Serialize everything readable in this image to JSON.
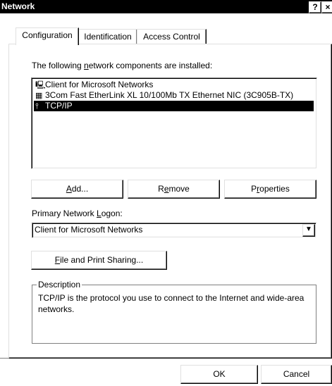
{
  "window": {
    "title": "Network",
    "help_label": "?",
    "close_label": "×"
  },
  "tabs": [
    {
      "label": "Configuration",
      "active": true
    },
    {
      "label": "Identification",
      "active": false
    },
    {
      "label": "Access Control",
      "active": false
    }
  ],
  "components": {
    "label_pre": "The following ",
    "label_accel": "n",
    "label_post": "etwork components are installed:",
    "items": [
      {
        "icon": "network-client-icon",
        "label": "Client for Microsoft Networks",
        "selected": false
      },
      {
        "icon": "network-card-icon",
        "label": "3Com Fast EtherLink XL 10/100Mb TX Ethernet NIC (3C905B-TX)",
        "selected": false
      },
      {
        "icon": "protocol-icon",
        "label": "TCP/IP",
        "selected": true
      }
    ]
  },
  "buttons": {
    "add": {
      "accel": "A",
      "rest": "dd..."
    },
    "remove": {
      "pre": "R",
      "accel": "e",
      "rest": "move"
    },
    "properties": {
      "pre": "P",
      "accel": "r",
      "rest": "operties"
    },
    "file_print": {
      "accel": "F",
      "rest": "ile and Print Sharing..."
    },
    "ok": "OK",
    "cancel": "Cancel"
  },
  "logon": {
    "label_pre": "Primary Network ",
    "label_accel": "L",
    "label_post": "ogon:",
    "value": "Client for Microsoft Networks"
  },
  "description": {
    "title": "Description",
    "text": "TCP/IP is the protocol you use to connect to the Internet and wide-area networks."
  }
}
